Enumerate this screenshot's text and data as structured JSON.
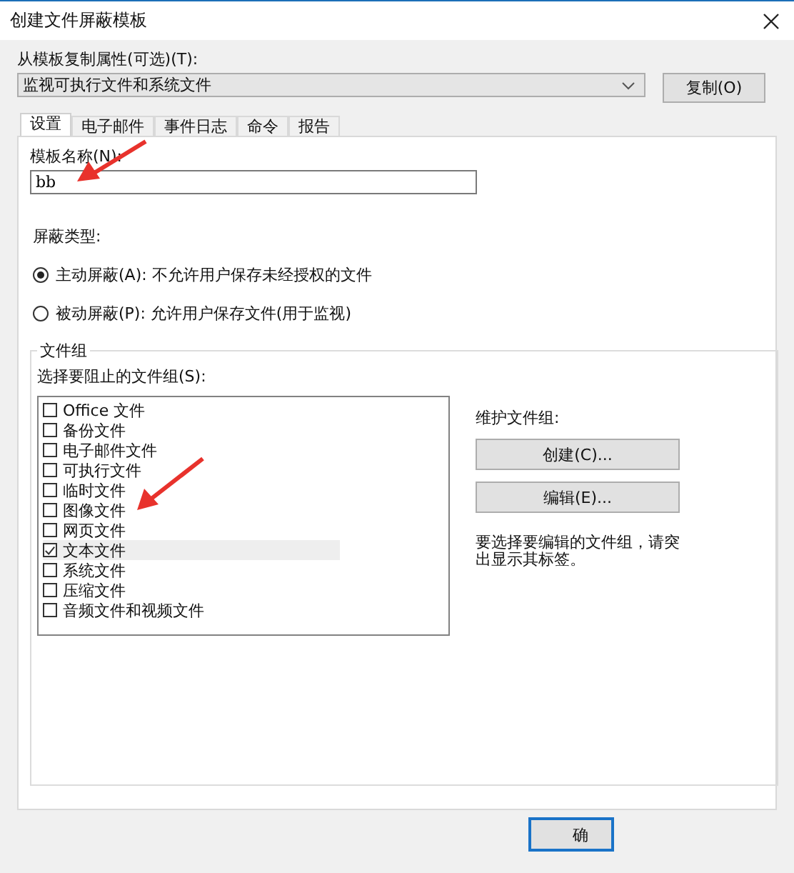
{
  "window": {
    "title": "创建文件屏蔽模板"
  },
  "copy_from": {
    "label": "从模板复制属性(可选)(T):",
    "value": "监视可执行文件和系统文件",
    "button": "复制(O)"
  },
  "tabs": [
    {
      "label": "设置",
      "selected": true
    },
    {
      "label": "电子邮件",
      "selected": false
    },
    {
      "label": "事件日志",
      "selected": false
    },
    {
      "label": "命令",
      "selected": false
    },
    {
      "label": "报告",
      "selected": false
    }
  ],
  "template_name": {
    "label": "模板名称(N):",
    "value": "bb"
  },
  "screening_type": {
    "label": "屏蔽类型:",
    "options": [
      {
        "label": "主动屏蔽(A): 不允许用户保存未经授权的文件",
        "selected": true
      },
      {
        "label": "被动屏蔽(P): 允许用户保存文件(用于监视)",
        "selected": false
      }
    ]
  },
  "file_groups": {
    "title": "文件组",
    "list_label": "选择要阻止的文件组(S):",
    "items": [
      {
        "label": "Office 文件",
        "checked": false
      },
      {
        "label": "备份文件",
        "checked": false
      },
      {
        "label": "电子邮件文件",
        "checked": false
      },
      {
        "label": "可执行文件",
        "checked": false
      },
      {
        "label": "临时文件",
        "checked": false
      },
      {
        "label": "图像文件",
        "checked": false
      },
      {
        "label": "网页文件",
        "checked": false
      },
      {
        "label": "文本文件",
        "checked": true
      },
      {
        "label": "系统文件",
        "checked": false
      },
      {
        "label": "压缩文件",
        "checked": false
      },
      {
        "label": "音频文件和视频文件",
        "checked": false
      }
    ],
    "maintain_label": "维护文件组:",
    "buttons": [
      "创建(C)...",
      "编辑(E)..."
    ],
    "hint": "要选择要编辑的文件组，请突出显示其标签。"
  },
  "footer_buttons": [
    "确"
  ]
}
